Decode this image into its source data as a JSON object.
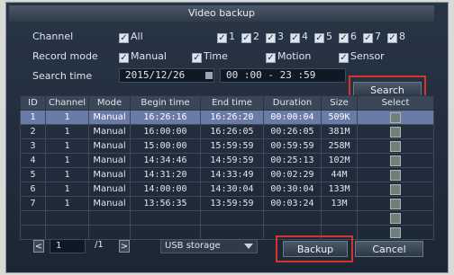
{
  "window": {
    "title": "Video backup"
  },
  "channel": {
    "label": "Channel",
    "all_label": "All",
    "items": [
      "1",
      "2",
      "3",
      "4",
      "5",
      "6",
      "7",
      "8"
    ]
  },
  "record_mode": {
    "label": "Record mode",
    "options": [
      "Manual",
      "Time",
      "Motion",
      "Sensor"
    ]
  },
  "search_time": {
    "label": "Search time",
    "date": "2015/12/26",
    "time_range": "00 :00 - 23 :59",
    "search_button": "Search"
  },
  "table": {
    "headers": [
      "ID",
      "Channel",
      "Mode",
      "Begin time",
      "End time",
      "Duration",
      "Size",
      "Select"
    ],
    "rows": [
      [
        "1",
        "1",
        "Manual",
        "16:26:16",
        "16:26:20",
        "00:00:04",
        "509K"
      ],
      [
        "2",
        "1",
        "Manual",
        "16:00:00",
        "16:26:05",
        "00:26:05",
        "381M"
      ],
      [
        "3",
        "1",
        "Manual",
        "15:00:00",
        "15:59:59",
        "00:59:59",
        "258M"
      ],
      [
        "4",
        "1",
        "Manual",
        "14:34:46",
        "14:59:59",
        "00:25:13",
        "102M"
      ],
      [
        "5",
        "1",
        "Manual",
        "14:31:20",
        "14:33:49",
        "00:02:29",
        "44M"
      ],
      [
        "6",
        "1",
        "Manual",
        "14:00:00",
        "14:30:04",
        "00:30:04",
        "133M"
      ],
      [
        "7",
        "1",
        "Manual",
        "13:56:35",
        "13:59:59",
        "00:03:24",
        "13M"
      ]
    ]
  },
  "footer": {
    "page_current": "1",
    "page_total": "/1",
    "storage": "USB storage",
    "backup_button": "Backup",
    "cancel_button": "Cancel"
  },
  "colors": {
    "highlight": "#d7332e",
    "selected_row": "#6a7ba8"
  }
}
